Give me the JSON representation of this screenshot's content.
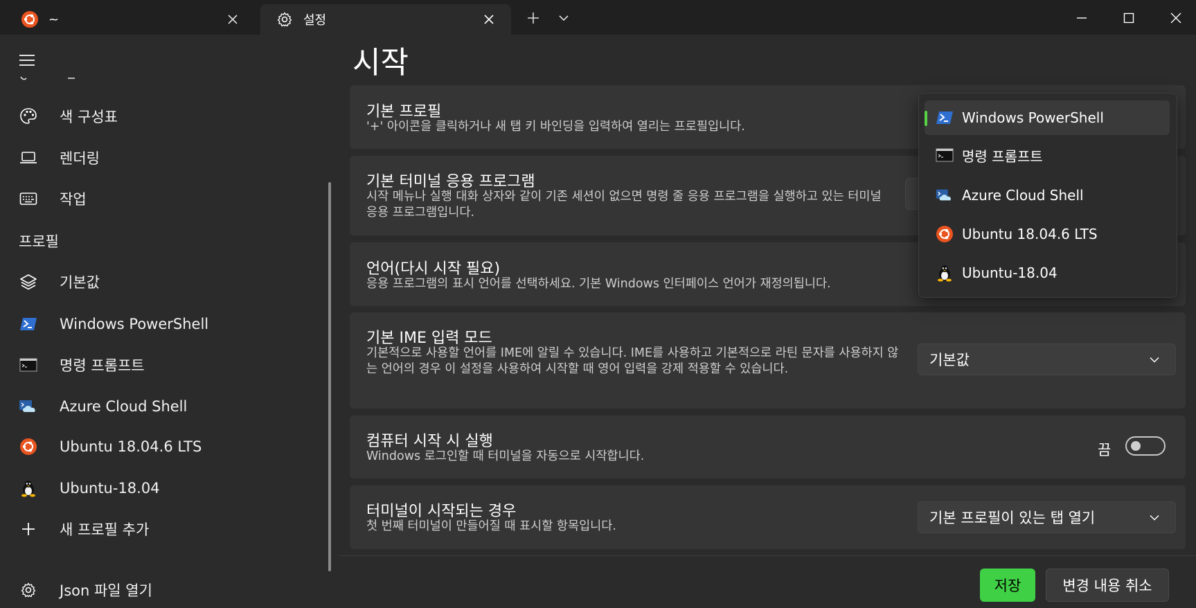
{
  "tabs": [
    {
      "title": "~",
      "icon": "ubuntu-icon"
    },
    {
      "title": "설정",
      "icon": "gear-icon"
    }
  ],
  "sidebar": {
    "items": [
      {
        "label": "색 구성표",
        "icon": "palette-icon"
      },
      {
        "label": "렌더링",
        "icon": "laptop-icon"
      },
      {
        "label": "작업",
        "icon": "keyboard-icon"
      }
    ],
    "profiles_header": "프로필",
    "profiles": [
      {
        "label": "기본값",
        "icon": "layers-icon"
      },
      {
        "label": "Windows PowerShell",
        "icon": "powershell-icon"
      },
      {
        "label": "명령 프롬프트",
        "icon": "cmd-icon"
      },
      {
        "label": "Azure Cloud Shell",
        "icon": "azure-icon"
      },
      {
        "label": "Ubuntu 18.04.6 LTS",
        "icon": "ubuntu-icon"
      },
      {
        "label": "Ubuntu-18.04",
        "icon": "linux-penguin-icon"
      }
    ],
    "add_profile": "새 프로필 추가",
    "open_json": "Json 파일 열기"
  },
  "main": {
    "title": "시작",
    "settings": [
      {
        "title": "기본 프로필",
        "desc": "'+' 아이콘을 클릭하거나 새 탭 키 바인딩을 입력하여 열리는 프로필입니다."
      },
      {
        "title": "기본 터미널 응용 프로그램",
        "desc": "시작 메뉴나 실행 대화 상자와 같이 기존 세션이 없으면 명령 줄 응용 프로그램을 실행하고 있는 터미널 응용 프로그램입니다."
      },
      {
        "title": "언어(다시 시작 필요)",
        "desc": "응용 프로그램의 표시 언어를 선택하세요. 기본 Windows 인터페이스 언어가 재정의됩니다."
      },
      {
        "title": "기본 IME 입력 모드",
        "desc": "기본적으로 사용할 언어를 IME에 알릴 수 있습니다. IME를 사용하고 기본적으로 라틴 문자를 사용하지 않는 언어의 경우 이 설정을 사용하여 시작할 때 영어 입력을 강제 적용할 수 있습니다.",
        "value": "기본값"
      },
      {
        "title": "컴퓨터 시작 시 실행",
        "desc": "Windows 로그인할 때 터미널을 자동으로 시작합니다.",
        "toggle_label": "끔",
        "toggle_on": false
      },
      {
        "title": "터미널이 시작되는 경우",
        "desc": "첫 번째 터미널이 만들어질 때 표시할 항목입니다.",
        "value": "기본 프로필이 있는 탭 열기"
      }
    ]
  },
  "profile_dropdown": {
    "selected_index": 0,
    "options": [
      {
        "label": "Windows PowerShell",
        "icon": "powershell-icon"
      },
      {
        "label": "명령 프롬프트",
        "icon": "cmd-icon"
      },
      {
        "label": "Azure Cloud Shell",
        "icon": "azure-icon"
      },
      {
        "label": "Ubuntu 18.04.6 LTS",
        "icon": "ubuntu-icon"
      },
      {
        "label": "Ubuntu-18.04",
        "icon": "linux-penguin-icon"
      }
    ]
  },
  "footer": {
    "save_label": "저장",
    "cancel_label": "변경 내용 취소"
  },
  "colors": {
    "accent": "#40d046",
    "background": "#2b2b2b",
    "titlebar": "#202020",
    "card": "#353535"
  }
}
